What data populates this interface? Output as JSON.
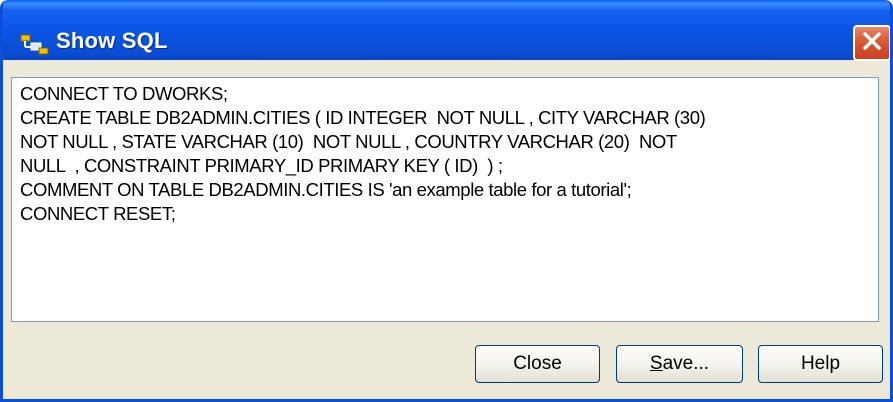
{
  "window": {
    "title": "Show SQL"
  },
  "sql": {
    "lines": [
      "CONNECT TO DWORKS;",
      "CREATE TABLE DB2ADMIN.CITIES ( ID INTEGER  NOT NULL , CITY VARCHAR (30)",
      "NOT NULL , STATE VARCHAR (10)  NOT NULL , COUNTRY VARCHAR (20)  NOT",
      "NULL  , CONSTRAINT PRIMARY_ID PRIMARY KEY ( ID)  ) ;",
      "COMMENT ON TABLE DB2ADMIN.CITIES IS 'an example table for a tutorial';",
      "CONNECT RESET;"
    ]
  },
  "buttons": {
    "close": "Close",
    "save_underlined": "S",
    "save_rest": "ave...",
    "help": "Help"
  },
  "colors": {
    "titlebar": "#0b55e6",
    "close_button": "#dd5a35",
    "dialog_bg": "#ece9d8"
  }
}
